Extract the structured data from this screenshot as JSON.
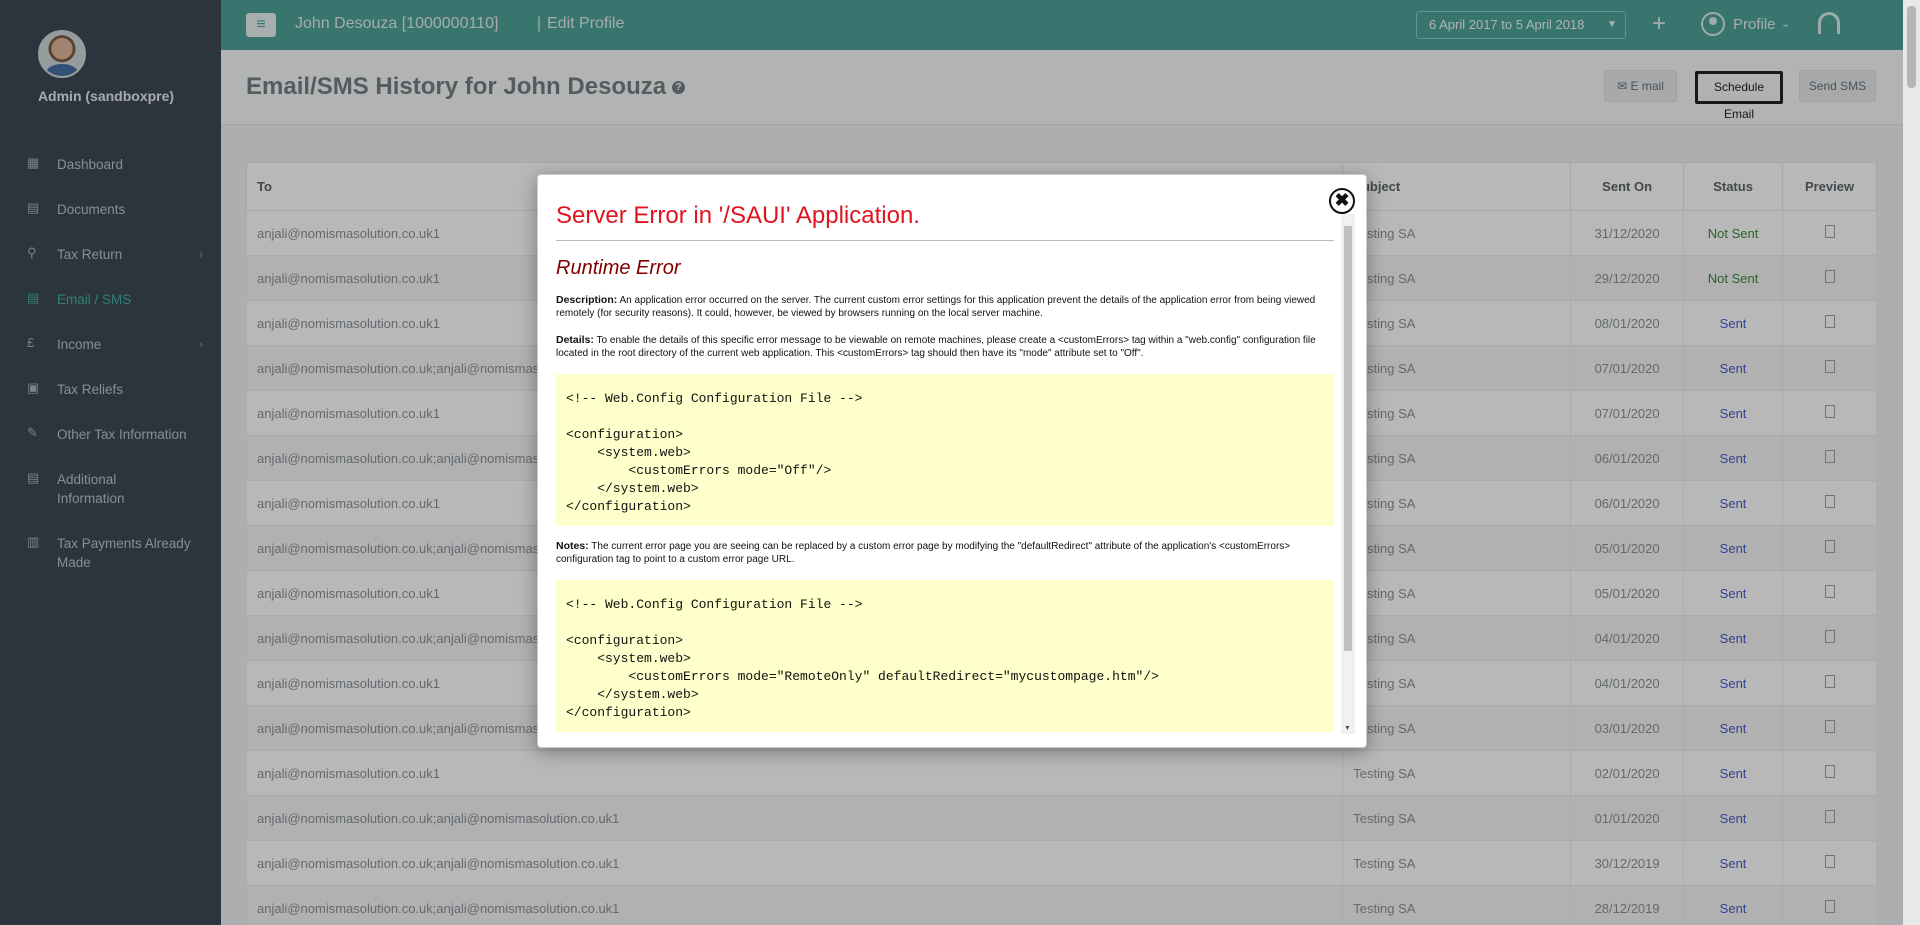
{
  "sidebar": {
    "admin_name": "Admin (sandboxpre)",
    "items": [
      {
        "label": "Dashboard",
        "icon": "dashboard-icon"
      },
      {
        "label": "Documents",
        "icon": "documents-icon"
      },
      {
        "label": "Tax Return",
        "icon": "tax-return-icon",
        "has_chevron": true
      },
      {
        "label": "Email / SMS",
        "icon": "email-icon",
        "active": true
      },
      {
        "label": "Income",
        "icon": "pound-icon",
        "has_chevron": true
      },
      {
        "label": "Tax Reliefs",
        "icon": "clipboard-icon"
      },
      {
        "label": "Other Tax Information",
        "icon": "info-icon"
      },
      {
        "label": "Additional Information",
        "icon": "list-icon"
      },
      {
        "label": "Tax Payments Already Made",
        "icon": "receipt-icon"
      }
    ]
  },
  "topbar": {
    "client": "John Desouza [1000000110]",
    "separator": "|",
    "edit_profile": "Edit Profile",
    "date_range": "6 April 2017 to 5 April 2018",
    "profile_label": "Profile"
  },
  "page": {
    "title": "Email/SMS History for John Desouza",
    "help": "?",
    "btn_email": "E mail",
    "btn_schedule": "Schedule Email",
    "btn_sms": "Send SMS"
  },
  "table": {
    "headers": [
      "To",
      "Subject",
      "Sent On",
      "Status",
      "Preview"
    ],
    "rows": [
      {
        "to": "anjali@nomismasolution.co.uk1",
        "subject": "Testing SA",
        "sent_on": "31/12/2020",
        "status": "Not Sent"
      },
      {
        "to": "anjali@nomismasolution.co.uk1",
        "subject": "Testing SA",
        "sent_on": "29/12/2020",
        "status": "Not Sent"
      },
      {
        "to": "anjali@nomismasolution.co.uk1",
        "subject": "Testing SA",
        "sent_on": "08/01/2020",
        "status": "Sent"
      },
      {
        "to": "anjali@nomismasolution.co.uk;anjali@nomismasolution.co.uk1",
        "subject": "Testing SA",
        "sent_on": "07/01/2020",
        "status": "Sent"
      },
      {
        "to": "anjali@nomismasolution.co.uk1",
        "subject": "Testing SA",
        "sent_on": "07/01/2020",
        "status": "Sent"
      },
      {
        "to": "anjali@nomismasolution.co.uk;anjali@nomismasolution.co.uk1",
        "subject": "Testing SA",
        "sent_on": "06/01/2020",
        "status": "Sent"
      },
      {
        "to": "anjali@nomismasolution.co.uk1",
        "subject": "Testing SA",
        "sent_on": "06/01/2020",
        "status": "Sent"
      },
      {
        "to": "anjali@nomismasolution.co.uk;anjali@nomismasolution.co.uk1",
        "subject": "Testing SA",
        "sent_on": "05/01/2020",
        "status": "Sent"
      },
      {
        "to": "anjali@nomismasolution.co.uk1",
        "subject": "Testing SA",
        "sent_on": "05/01/2020",
        "status": "Sent"
      },
      {
        "to": "anjali@nomismasolution.co.uk;anjali@nomismasolution.co.uk1",
        "subject": "Testing SA",
        "sent_on": "04/01/2020",
        "status": "Sent"
      },
      {
        "to": "anjali@nomismasolution.co.uk1",
        "subject": "Testing SA",
        "sent_on": "04/01/2020",
        "status": "Sent"
      },
      {
        "to": "anjali@nomismasolution.co.uk;anjali@nomismasolution.co.uk1",
        "subject": "Testing SA",
        "sent_on": "03/01/2020",
        "status": "Sent"
      },
      {
        "to": "anjali@nomismasolution.co.uk1",
        "subject": "Testing SA",
        "sent_on": "02/01/2020",
        "status": "Sent"
      },
      {
        "to": "anjali@nomismasolution.co.uk;anjali@nomismasolution.co.uk1",
        "subject": "Testing SA",
        "sent_on": "01/01/2020",
        "status": "Sent"
      },
      {
        "to": "anjali@nomismasolution.co.uk;anjali@nomismasolution.co.uk1",
        "subject": "Testing SA",
        "sent_on": "30/12/2019",
        "status": "Sent"
      },
      {
        "to": "anjali@nomismasolution.co.uk;anjali@nomismasolution.co.uk1",
        "subject": "Testing SA",
        "sent_on": "28/12/2019",
        "status": "Sent"
      }
    ]
  },
  "modal": {
    "close": "✖",
    "title": "Server Error in '/SAUI' Application.",
    "subtitle": "Runtime Error",
    "desc_label": "Description:",
    "desc_text": "An application error occurred on the server. The current custom error settings for this application prevent the details of the application error from being viewed remotely (for security reasons). It could, however, be viewed by browsers running on the local server machine.",
    "details_label": "Details:",
    "details_text": "To enable the details of this specific error message to be viewable on remote machines, please create a <customErrors> tag within a \"web.config\" configuration file located in the root directory of the current web application. This <customErrors> tag should then have its \"mode\" attribute set to \"Off\".",
    "code1": "<!-- Web.Config Configuration File -->\n\n<configuration>\n    <system.web>\n        <customErrors mode=\"Off\"/>\n    </system.web>\n</configuration>",
    "notes_label": "Notes:",
    "notes_text": "The current error page you are seeing can be replaced by a custom error page by modifying the \"defaultRedirect\" attribute of the application's <customErrors> configuration tag to point to a custom error page URL.",
    "code2": "<!-- Web.Config Configuration File -->\n\n<configuration>\n    <system.web>\n        <customErrors mode=\"RemoteOnly\" defaultRedirect=\"mycustompage.htm\"/>\n    </system.web>\n</configuration>"
  }
}
